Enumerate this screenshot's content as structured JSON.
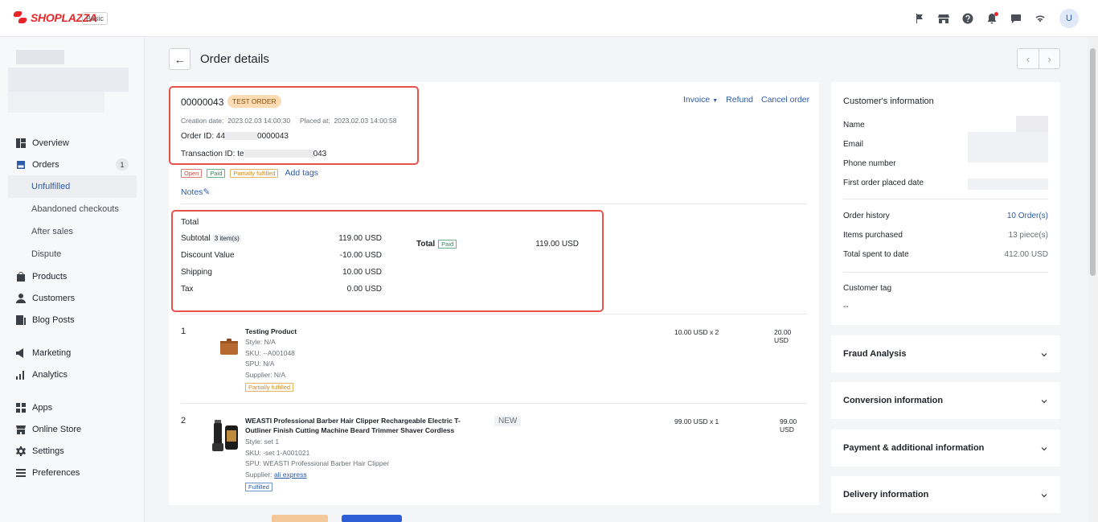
{
  "app": {
    "brand": "SHOPLAZZA",
    "plan": "Basic",
    "avatar_letter": "U"
  },
  "topbar_icons": [
    "flag-icon",
    "store-icon",
    "help-icon",
    "bell-icon",
    "chat-icon",
    "wifi-icon"
  ],
  "sidebar": {
    "items": [
      {
        "label": "Overview",
        "icon": "overview-icon"
      },
      {
        "label": "Orders",
        "icon": "orders-icon",
        "count": "1"
      },
      {
        "label": "Unfulfilled",
        "sub": true,
        "active": true
      },
      {
        "label": "Abandoned checkouts",
        "sub": true
      },
      {
        "label": "After sales",
        "sub": true
      },
      {
        "label": "Dispute",
        "sub": true
      },
      {
        "label": "Products",
        "icon": "products-icon"
      },
      {
        "label": "Customers",
        "icon": "customers-icon"
      },
      {
        "label": "Blog Posts",
        "icon": "blog-icon"
      },
      {
        "label": "Marketing",
        "icon": "marketing-icon"
      },
      {
        "label": "Analytics",
        "icon": "analytics-icon"
      },
      {
        "label": "Apps",
        "icon": "apps-icon"
      },
      {
        "label": "Online Store",
        "icon": "online-store-icon"
      },
      {
        "label": "Settings",
        "icon": "settings-icon"
      },
      {
        "label": "Preferences",
        "icon": "preferences-icon"
      }
    ]
  },
  "page": {
    "title": "Order details"
  },
  "order": {
    "number": "00000043",
    "test_badge": "TEST ORDER",
    "creation_label": "Creation date:",
    "creation_date": "2023.02.03 14:00:30",
    "placed_label": "Placed at:",
    "placed_date": "2023.02.03 14:00:58",
    "order_id_label": "Order ID:",
    "order_id_start": "44",
    "order_id_end": "0000043",
    "tx_label": "Transaction ID:",
    "tx_start": "te",
    "tx_end": "043",
    "actions": {
      "invoice": "Invoice",
      "refund": "Refund",
      "cancel": "Cancel order"
    },
    "tags": {
      "open": "Open",
      "paid": "Paid",
      "partial": "Partially fulfilled",
      "add": "Add tags"
    },
    "notes": "Notes"
  },
  "totals": {
    "title": "Total",
    "subtotal_label": "Subtotal",
    "subtotal_items": "3 item(s)",
    "subtotal": "119.00 USD",
    "discount_label": "Discount Value",
    "discount": "-10.00 USD",
    "shipping_label": "Shipping",
    "shipping": "10.00 USD",
    "tax_label": "Tax",
    "tax": "0.00 USD",
    "total_label": "Total",
    "total_status": "Paid",
    "total": "119.00 USD"
  },
  "items": [
    {
      "index": "1",
      "name": "Testing Product",
      "style": "Style: N/A",
      "sku": "SKU: --A001048",
      "spu": "SPU: N/A",
      "supplier": "Supplier: N/A",
      "status": "Partially fulfilled",
      "price_qty": "10.00 USD x 2",
      "amount": "20.00 USD"
    },
    {
      "index": "2",
      "name": "WEASTI Professional Barber Hair Clipper Rechargeable Electric T-Outliner Finish Cutting Machine Beard Trimmer Shaver Cordless",
      "badge": "NEW",
      "style": "Style: set 1",
      "sku": "SKU: -set 1-A001021",
      "spu": "SPU: WEASTI Professional Barber Hair Clipper",
      "supplier_label": "Supplier:",
      "supplier_link": "ali express",
      "status": "Fulfilled",
      "price_qty": "99.00 USD x 1",
      "amount": "99.00 USD"
    }
  ],
  "customer": {
    "title": "Customer's information",
    "name_label": "Name",
    "email_label": "Email",
    "phone_label": "Phone number",
    "first_order_label": "First order placed date",
    "history_label": "Order history",
    "history": "10 Order(s)",
    "purchased_label": "Items purchased",
    "purchased": "13 piece(s)",
    "spent_label": "Total spent to date",
    "spent": "412.00 USD",
    "tag_label": "Customer tag",
    "tag_value": "--"
  },
  "panels": [
    {
      "title": "Fraud Analysis"
    },
    {
      "title": "Conversion information"
    },
    {
      "title": "Payment & additional information"
    },
    {
      "title": "Delivery information"
    }
  ],
  "colors": {
    "accent": "#2d5ba8",
    "brand": "#e8262a",
    "highlight": "#e5534b"
  }
}
